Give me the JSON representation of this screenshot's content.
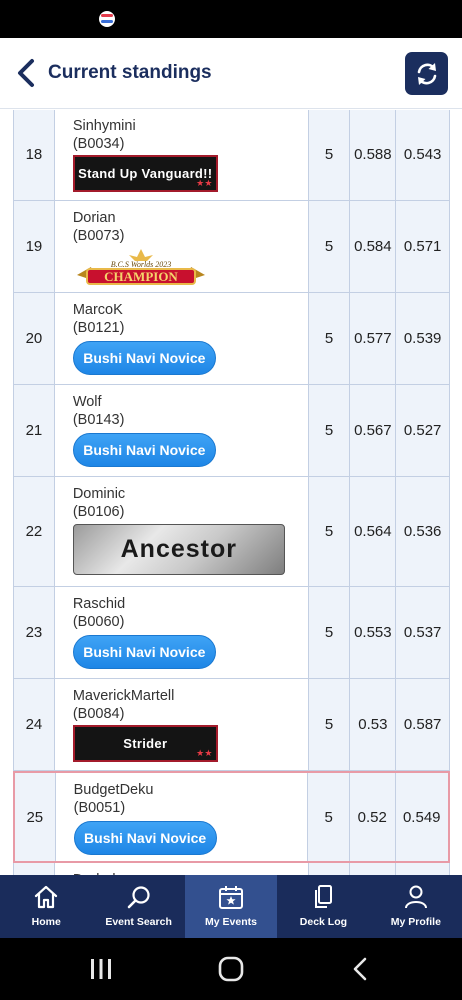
{
  "header": {
    "title": "Current standings"
  },
  "rows": [
    {
      "rank": "18",
      "name": "Sinhymini",
      "id": "(B0034)",
      "badge": "Stand Up Vanguard!!",
      "badge_type": "dark",
      "points": "5",
      "omw": "0.588",
      "oomw": "0.543"
    },
    {
      "rank": "19",
      "name": "Dorian",
      "id": "(B0073)",
      "badge": "CHAMPION",
      "badge_type": "champion",
      "points": "5",
      "omw": "0.584",
      "oomw": "0.571"
    },
    {
      "rank": "20",
      "name": "MarcoK",
      "id": "(B0121)",
      "badge": "Bushi Navi Novice",
      "badge_type": "novice",
      "points": "5",
      "omw": "0.577",
      "oomw": "0.539"
    },
    {
      "rank": "21",
      "name": "Wolf",
      "id": "(B0143)",
      "badge": "Bushi Navi Novice",
      "badge_type": "novice",
      "points": "5",
      "omw": "0.567",
      "oomw": "0.527"
    },
    {
      "rank": "22",
      "name": "Dominic",
      "id": "(B0106)",
      "badge": "Ancestor",
      "badge_type": "ancestor",
      "points": "5",
      "omw": "0.564",
      "oomw": "0.536"
    },
    {
      "rank": "23",
      "name": "Raschid",
      "id": "(B0060)",
      "badge": "Bushi Navi Novice",
      "badge_type": "novice",
      "points": "5",
      "omw": "0.553",
      "oomw": "0.537"
    },
    {
      "rank": "24",
      "name": "MaverickMartell",
      "id": "(B0084)",
      "badge": "Strider",
      "badge_type": "dark",
      "points": "5",
      "omw": "0.53",
      "oomw": "0.587"
    },
    {
      "rank": "25",
      "name": "BudgetDeku",
      "id": "(B0051)",
      "badge": "Bushi Navi Novice",
      "badge_type": "novice",
      "points": "5",
      "omw": "0.52",
      "oomw": "0.549",
      "highlight": true
    },
    {
      "rank": "",
      "name": "Dudad",
      "id": "",
      "badge": "",
      "badge_type": "",
      "points": "",
      "omw": "",
      "oomw": ""
    }
  ],
  "champion_subtext": "B.C.S Worlds 2023",
  "nav": [
    {
      "label": "Home",
      "icon": "home-icon"
    },
    {
      "label": "Event Search",
      "icon": "search-icon"
    },
    {
      "label": "My Events",
      "icon": "calendar-star-icon",
      "active": true
    },
    {
      "label": "Deck Log",
      "icon": "cards-icon"
    },
    {
      "label": "My Profile",
      "icon": "person-icon"
    }
  ],
  "colors": {
    "navy": "#1b2e5e",
    "nav_bg": "#1a2c5b",
    "nav_active": "#33508f",
    "cell_bg": "#eef3fa",
    "novice_blue": "#1e86e6",
    "highlight_border": "#e89aa6"
  }
}
